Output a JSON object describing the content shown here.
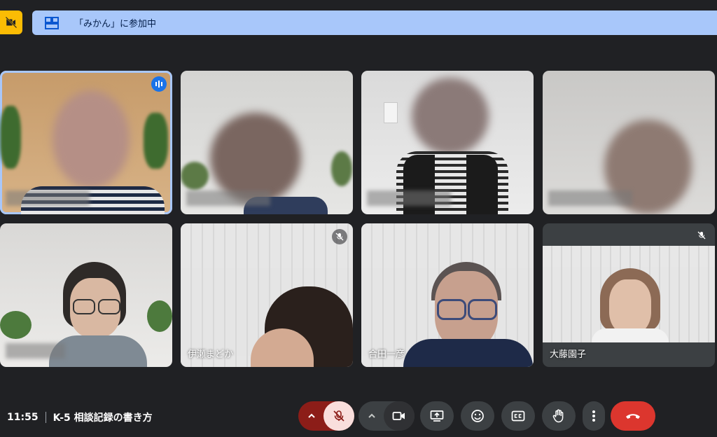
{
  "banner": {
    "join_text": "「みかん」に参加中"
  },
  "participants": [
    {
      "name": "",
      "mic_muted": false,
      "speaking": true
    },
    {
      "name": "",
      "mic_muted": false,
      "speaking": false
    },
    {
      "name": "",
      "mic_muted": false,
      "speaking": false
    },
    {
      "name": "",
      "mic_muted": false,
      "speaking": false
    },
    {
      "name": "",
      "mic_muted": false,
      "speaking": false
    },
    {
      "name": "伊瀬まどか",
      "mic_muted": true,
      "speaking": false
    },
    {
      "name": "合田一彦",
      "mic_muted": false,
      "speaking": false
    },
    {
      "name": "大藤園子",
      "mic_muted": true,
      "speaking": false
    }
  ],
  "meeting": {
    "time": "11:55",
    "title": "K-5 相談記録の書き方"
  },
  "controls": {
    "mic": "mic-off-icon",
    "camera": "videocam-icon",
    "present": "present-screen-icon",
    "reactions": "emoji-icon",
    "captions": "closed-captions-icon",
    "raise_hand": "hand-icon",
    "more": "more-vert-icon",
    "leave": "call-end-icon"
  },
  "colors": {
    "background": "#202124",
    "banner": "#a8c7fa",
    "warning": "#fbbc04",
    "mic_off_active": "#f9dedc",
    "mic_off_dark": "#8c1d18",
    "leave": "#ea4335",
    "speaking": "#1a73e8"
  }
}
